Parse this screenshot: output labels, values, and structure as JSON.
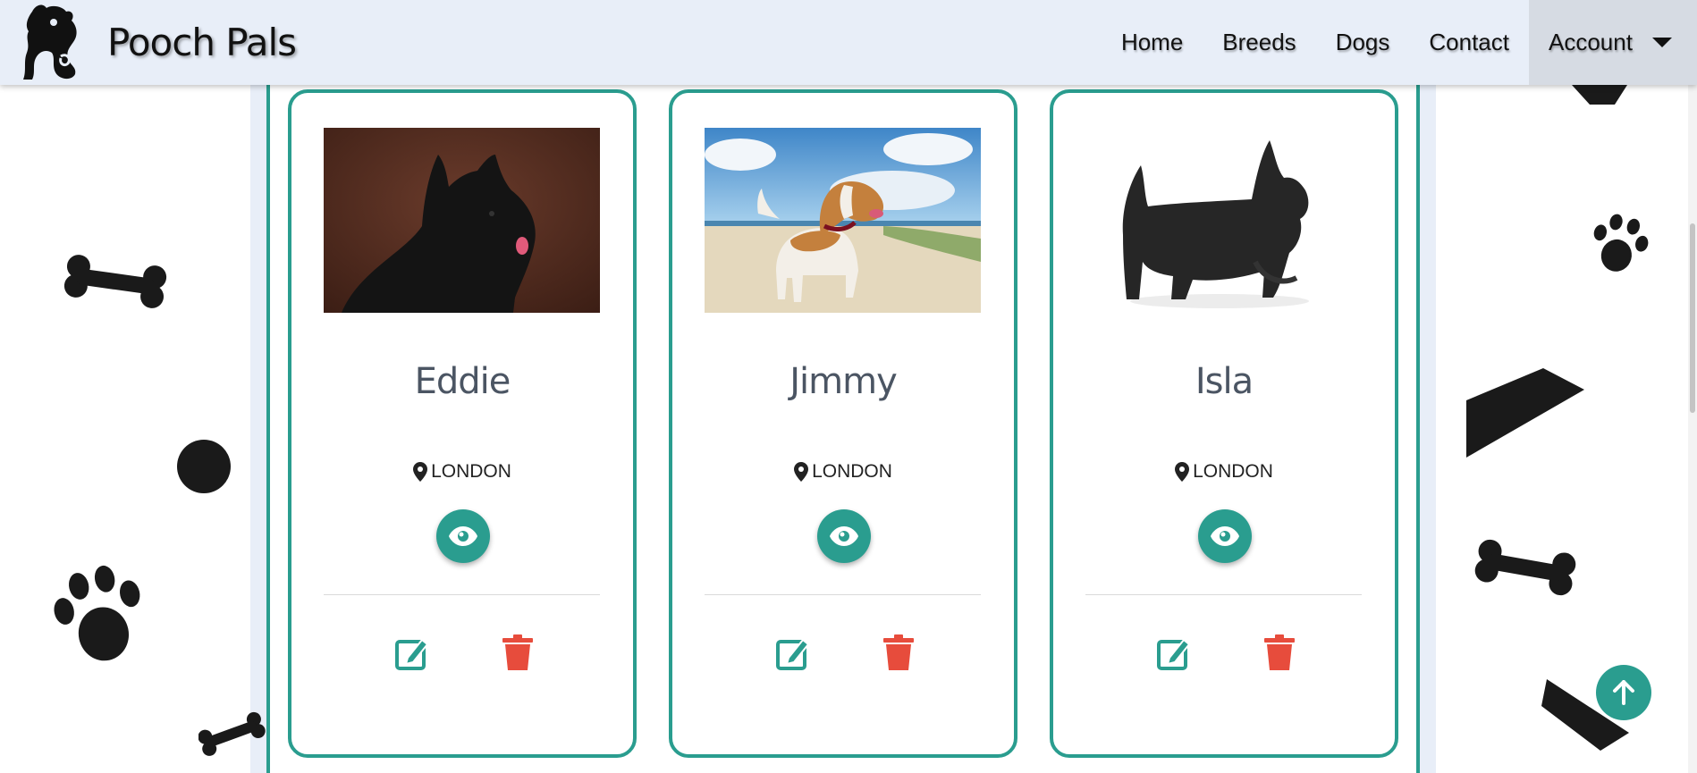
{
  "navbar": {
    "brand_name": "Pooch Pals",
    "links": [
      "Home",
      "Breeds",
      "Dogs",
      "Contact"
    ],
    "account_label": "Account"
  },
  "icons": {
    "brand": "dog-logo-icon",
    "location": "map-marker-icon",
    "view": "eye-icon",
    "edit": "edit-icon",
    "delete": "trash-icon",
    "back_to_top": "arrow-up-icon",
    "account_dropdown": "caret-down-icon"
  },
  "colors": {
    "accent": "#2a9d8f",
    "delete": "#e74c3c",
    "navbar_bg": "#e8eef8"
  },
  "dogs": [
    {
      "name": "Eddie",
      "location": "LONDON",
      "photo": "scottish-terrier-portrait"
    },
    {
      "name": "Jimmy",
      "location": "LONDON",
      "photo": "beagle-on-beach"
    },
    {
      "name": "Isla",
      "location": "LONDON",
      "photo": "scottish-terrier-side"
    }
  ]
}
